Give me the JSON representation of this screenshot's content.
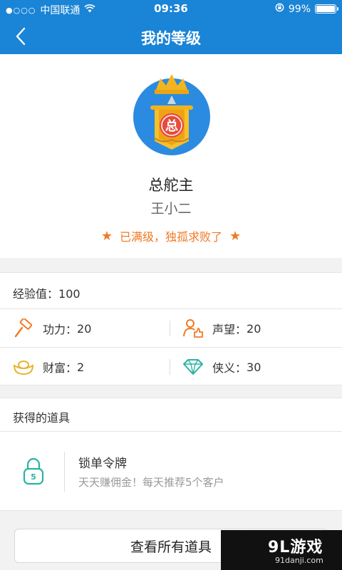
{
  "status_bar": {
    "signal_dots": "●○○○",
    "carrier": "中国联通",
    "time": "09:36",
    "battery_percent": "99%",
    "battery_level": 0.99
  },
  "nav": {
    "title": "我的等级"
  },
  "profile": {
    "rank_name": "总舵主",
    "user_name": "王小二",
    "level_message": "已满级，独孤求败了",
    "badge_char": "总"
  },
  "stats": {
    "exp_label": "经验值：",
    "exp_value": "100",
    "items": [
      {
        "label": "功力：",
        "value": "20",
        "icon": "hammer-icon"
      },
      {
        "label": "声望：",
        "value": "20",
        "icon": "user-thumbs-up-icon"
      },
      {
        "label": "财富：",
        "value": "2",
        "icon": "gold-ingot-icon"
      },
      {
        "label": "侠义：",
        "value": "30",
        "icon": "diamond-icon"
      }
    ]
  },
  "props": {
    "header": "获得的道具",
    "items": [
      {
        "name": "锁单令牌",
        "desc": "天天赚佣金！每天推荐5个客户",
        "icon": "lock-token-icon",
        "icon_number": "5"
      }
    ],
    "all_button": "查看所有道具"
  },
  "watermark": {
    "main": "9L游戏",
    "sub": "91danji.com"
  },
  "colors": {
    "primary": "#1a84d6",
    "accent": "#f07a24",
    "teal": "#2bb3a3",
    "gold": "#e8b430"
  }
}
